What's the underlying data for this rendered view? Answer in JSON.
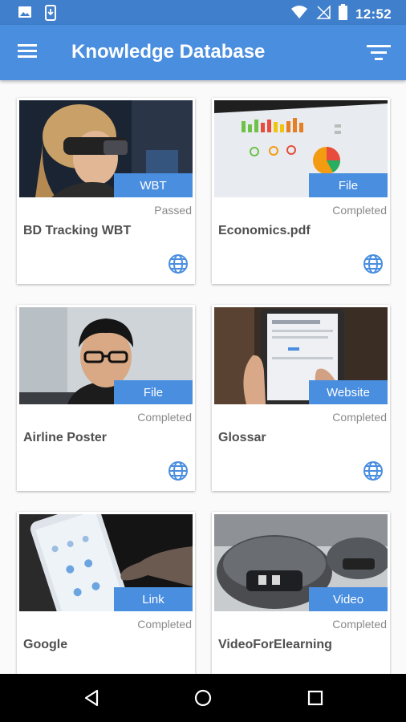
{
  "status_bar": {
    "time": "12:52",
    "icons": [
      "image-icon",
      "phone-download-icon",
      "wifi-icon",
      "no-signal-icon",
      "battery-icon"
    ]
  },
  "app_bar": {
    "title": "Knowledge Database",
    "menu_icon": "menu-icon",
    "filter_icon": "filter-icon"
  },
  "colors": {
    "primary": "#4a8ee0",
    "status_bar": "#3f7fcc",
    "card_text": "#4f4f4f",
    "muted_text": "#8a8a8a"
  },
  "items": [
    {
      "name": "BD Tracking WBT",
      "type": "WBT",
      "status": "Passed",
      "image": "person-with-ar-headset"
    },
    {
      "name": "Economics.pdf",
      "type": "File",
      "status": "Completed",
      "image": "screen-with-charts"
    },
    {
      "name": "Airline Poster",
      "type": "File",
      "status": "Completed",
      "image": "man-with-glasses-at-computer"
    },
    {
      "name": "Glossar",
      "type": "Website",
      "status": "Completed",
      "image": "hand-on-tablet"
    },
    {
      "name": "Google",
      "type": "Link",
      "status": "Completed",
      "image": "hand-holding-smartphone"
    },
    {
      "name": "VideoForElearning",
      "type": "Video",
      "status": "Completed",
      "image": "robotic-devices"
    }
  ],
  "nav_bar": {
    "back_icon": "back-icon",
    "home_icon": "home-icon",
    "recents_icon": "recents-icon"
  }
}
